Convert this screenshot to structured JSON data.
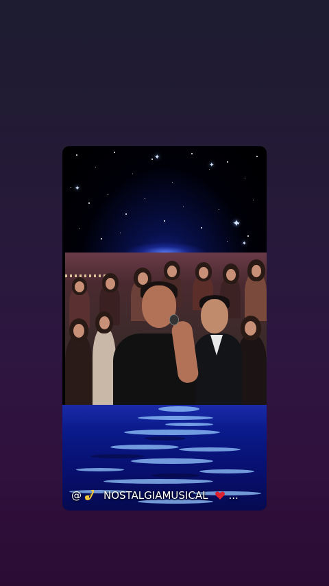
{
  "caption": {
    "at_symbol": "@",
    "handle_icon": "saxophone-icon",
    "channel_name": "NOSTALGIAMUSICAL",
    "heart_icon": "red-heart-icon",
    "ellipsis": "..."
  },
  "colors": {
    "background_top": "#1d1c30",
    "background_bottom": "#2a0c33",
    "sea_blue": "#0a1a8a",
    "heart_red": "#e0212f"
  }
}
